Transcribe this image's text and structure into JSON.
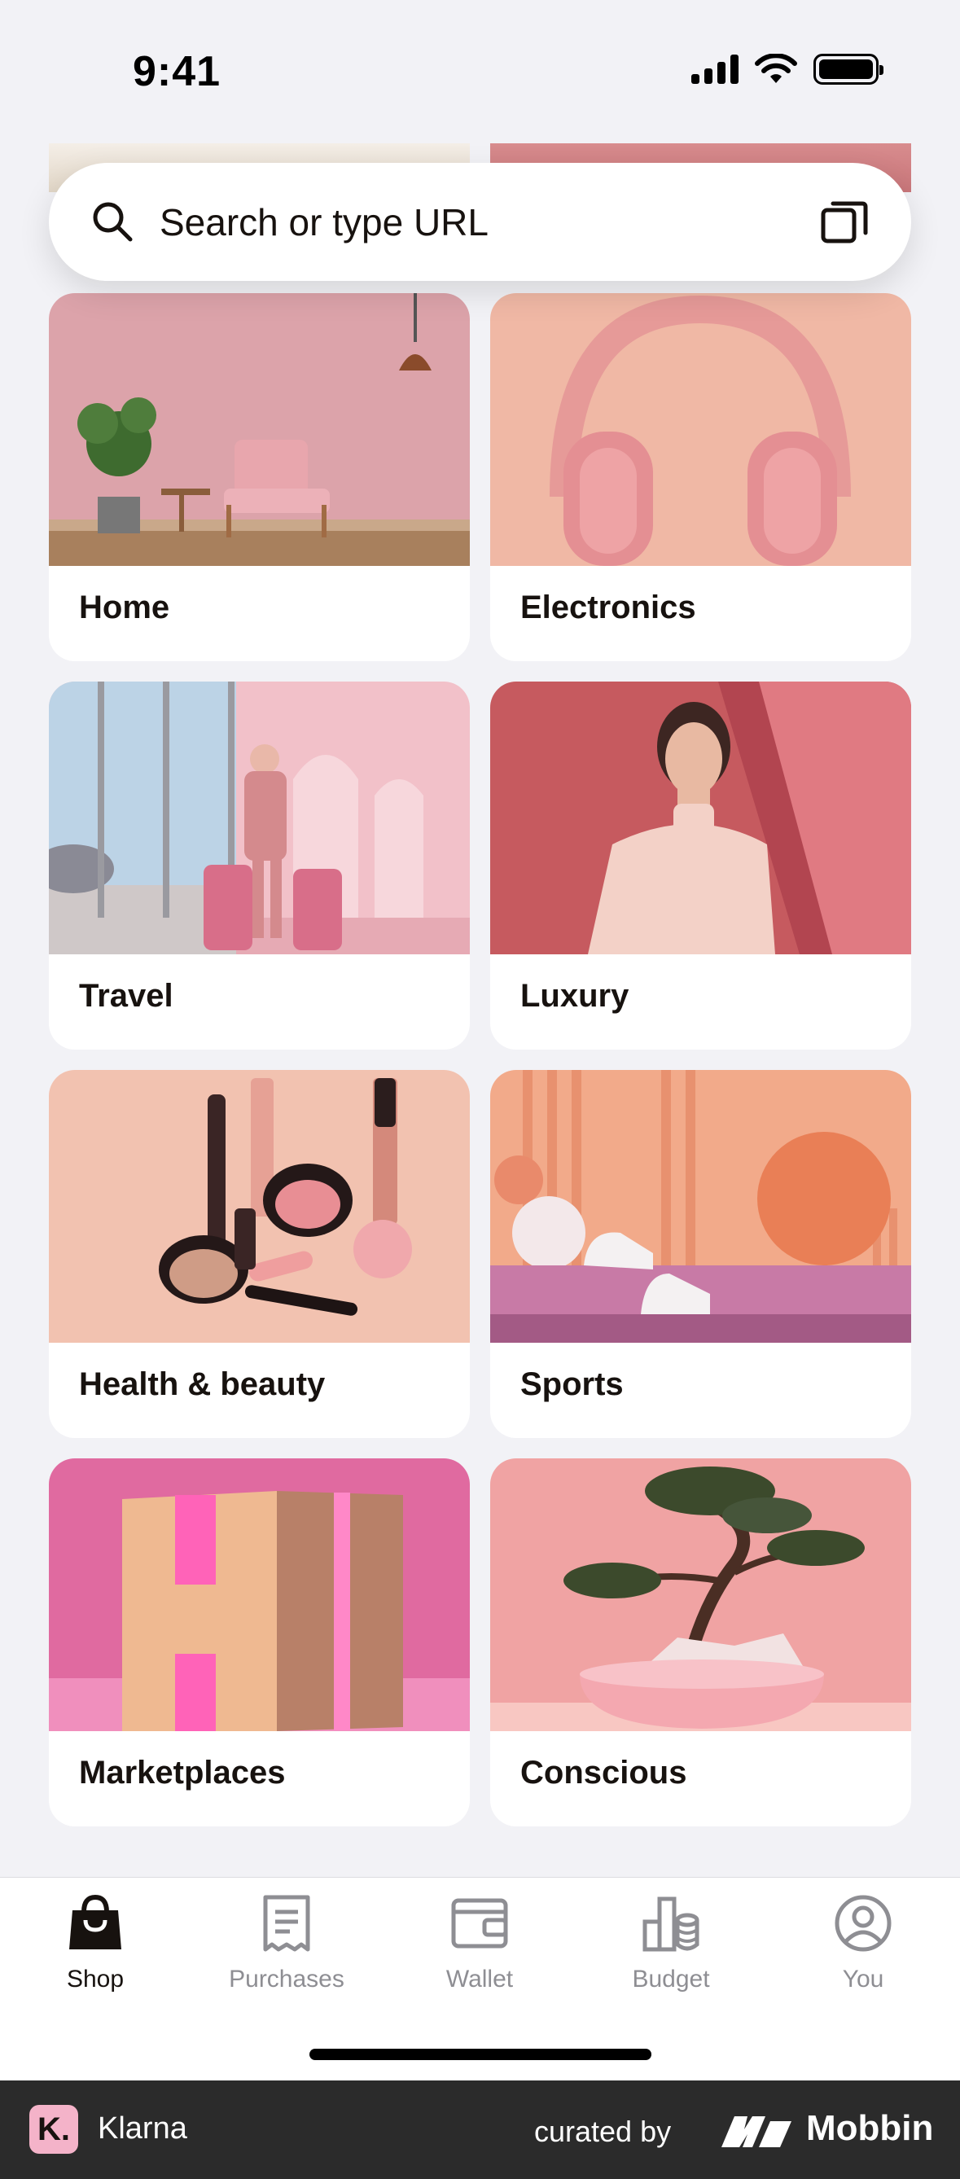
{
  "status_bar": {
    "time": "9:41"
  },
  "search": {
    "placeholder": "Search or type URL"
  },
  "categories": [
    {
      "label": "Home",
      "icon": "home-photo"
    },
    {
      "label": "Electronics",
      "icon": "headphones-photo"
    },
    {
      "label": "Travel",
      "icon": "travel-photo"
    },
    {
      "label": "Luxury",
      "icon": "fashion-photo"
    },
    {
      "label": "Health & beauty",
      "icon": "makeup-photo"
    },
    {
      "label": "Sports",
      "icon": "sports-photo"
    },
    {
      "label": "Marketplaces",
      "icon": "box-photo"
    },
    {
      "label": "Conscious",
      "icon": "bonsai-photo"
    }
  ],
  "tab_bar": {
    "items": [
      {
        "label": "Shop",
        "icon": "shopping-bag-icon",
        "active": true
      },
      {
        "label": "Purchases",
        "icon": "receipt-icon",
        "active": false
      },
      {
        "label": "Wallet",
        "icon": "wallet-icon",
        "active": false
      },
      {
        "label": "Budget",
        "icon": "budget-icon",
        "active": false
      },
      {
        "label": "You",
        "icon": "profile-icon",
        "active": false
      }
    ]
  },
  "footer": {
    "app_logo_letter": "K.",
    "app_name": "Klarna",
    "curated_by": "curated by",
    "brand": "Mobbin"
  },
  "colors": {
    "background": "#f2f2f6",
    "text": "#17120f",
    "inactive_tab": "#8e8e93",
    "klarna_pink": "#f4b3c9"
  }
}
